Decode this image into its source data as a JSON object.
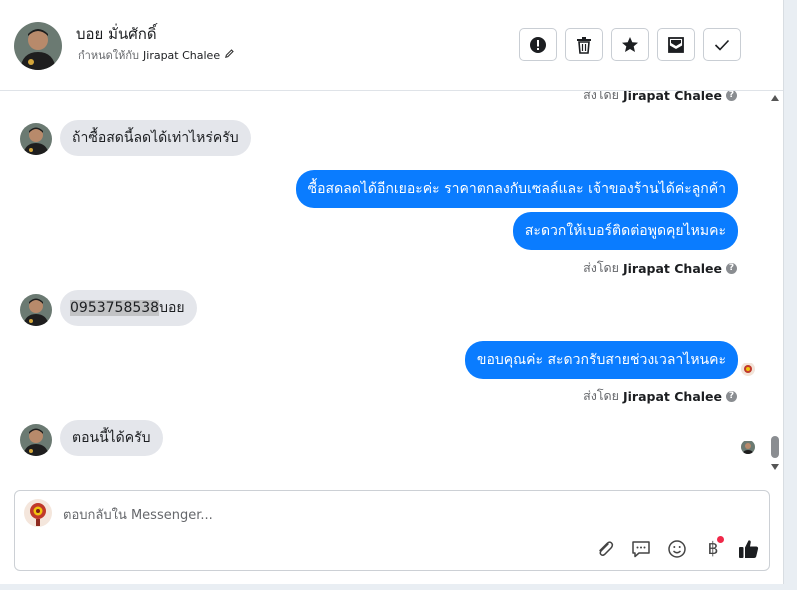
{
  "header": {
    "contact_name": "บอย มั่นศักดิ์",
    "assign_prefix": "กำหนดให้กับ",
    "assigned_agent": "Jirapat Chalee",
    "actions": [
      {
        "name": "report-button",
        "icon": "exclamation-circle-icon"
      },
      {
        "name": "delete-button",
        "icon": "trash-icon"
      },
      {
        "name": "star-button",
        "icon": "star-icon"
      },
      {
        "name": "mark-unread-button",
        "icon": "envelope-icon"
      },
      {
        "name": "done-button",
        "icon": "check-icon"
      }
    ]
  },
  "conversation": {
    "sent_by_prefix": "ส่งโดย",
    "sent_by_agent": "Jirapat Chalee",
    "incoming_1": "ถ้าซื้อสดนี้ลดได้เท่าไหร่ครับ",
    "outgoing_1": "ซื้อสดลดได้อีกเยอะค่ะ ราคาตกลงกับเซลล์และ เจ้าของร้านได้ค่ะลูกค้า",
    "outgoing_2": "สะดวกให้เบอร์ติดต่อพูดคุยไหมคะ",
    "incoming_2_phone": "0953758538",
    "incoming_2_name": "บอย",
    "outgoing_3": "ขอบคุณค่ะ สะดวกรับสายช่วงเวลาไหนคะ",
    "incoming_3": "ตอนนี้ได้ครับ"
  },
  "composer": {
    "placeholder": "ตอบกลับใน Messenger...",
    "currency_symbol": "฿"
  },
  "colors": {
    "outgoing_bubble": "#0a7cff",
    "incoming_bubble": "#e4e6eb",
    "notification_dot": "#f02849"
  }
}
